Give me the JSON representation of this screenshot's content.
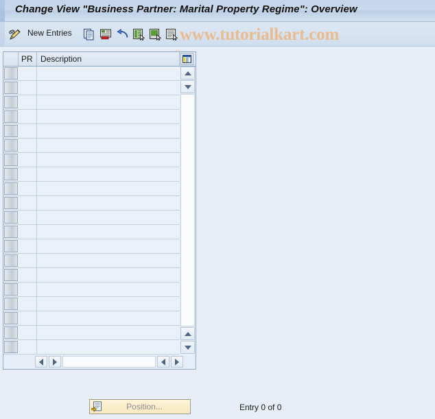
{
  "window": {
    "title": "Change View \"Business Partner: Marital Property Regime\": Overview"
  },
  "toolbar": {
    "edit_icon": "pencil-icon",
    "new_entries_label": "New Entries",
    "buttons": [
      {
        "name": "copy-as-icon",
        "tooltip": "Copy As..."
      },
      {
        "name": "delete-icon",
        "tooltip": "Delete"
      },
      {
        "name": "undo-icon",
        "tooltip": "Undo Change"
      },
      {
        "name": "select-all-icon",
        "tooltip": "Select All"
      },
      {
        "name": "deselect-all-icon",
        "tooltip": "Deselect All"
      },
      {
        "name": "select-block-icon",
        "tooltip": "Select Block"
      }
    ]
  },
  "watermark": {
    "text": "www.tutorialkart.com",
    "color": "#e9bb8e"
  },
  "table": {
    "columns": [
      {
        "key": "select",
        "label": ""
      },
      {
        "key": "pr",
        "label": "PR"
      },
      {
        "key": "description",
        "label": "Description"
      }
    ],
    "config_icon": "table-settings-icon",
    "row_count": 20,
    "rows": [],
    "vertical_scrollbar": {
      "up_icon": "scroll-up-icon",
      "down_icon": "scroll-down-icon",
      "bottom_up_icon": "scroll-up-icon",
      "bottom_down_icon": "scroll-down-icon"
    },
    "horizontal_scrollbar": {
      "first_icon": "scroll-left-icon",
      "prev_icon": "scroll-right-icon",
      "next_icon": "scroll-left-icon",
      "last_icon": "scroll-right-icon"
    }
  },
  "footer": {
    "position_button_label": "Position...",
    "position_button_icon": "position-icon",
    "entry_status": "Entry 0 of 0"
  },
  "colors": {
    "background": "#e8eef7",
    "title_bar": "#c9d9ec",
    "table_cell": "#eaf0f8",
    "button_yellow": "#f9edc6",
    "border": "#8fa9c4"
  }
}
